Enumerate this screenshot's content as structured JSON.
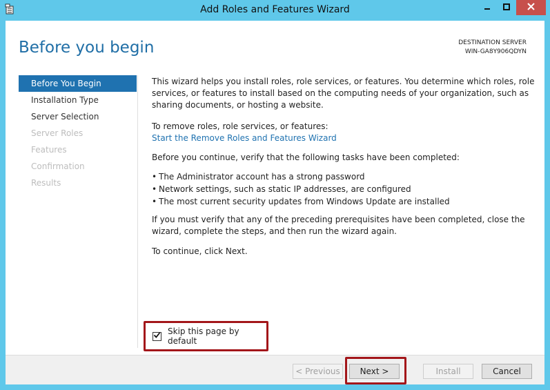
{
  "window": {
    "title": "Add Roles and Features Wizard"
  },
  "header": {
    "page_title": "Before you begin",
    "destination_label": "DESTINATION SERVER",
    "destination_server": "WIN-GA8Y906QDYN"
  },
  "nav": {
    "items": [
      {
        "label": "Before You Begin",
        "state": "selected"
      },
      {
        "label": "Installation Type",
        "state": "enabled"
      },
      {
        "label": "Server Selection",
        "state": "enabled"
      },
      {
        "label": "Server Roles",
        "state": "disabled"
      },
      {
        "label": "Features",
        "state": "disabled"
      },
      {
        "label": "Confirmation",
        "state": "disabled"
      },
      {
        "label": "Results",
        "state": "disabled"
      }
    ]
  },
  "content": {
    "intro": "This wizard helps you install roles, role services, or features. You determine which roles, role services, or features to install based on the computing needs of your organization, such as sharing documents, or hosting a website.",
    "remove_heading": "To remove roles, role services, or features:",
    "remove_link": "Start the Remove Roles and Features Wizard",
    "verify_heading": "Before you continue, verify that the following tasks have been completed:",
    "tasks": [
      "The Administrator account has a strong password",
      "Network settings, such as static IP addresses, are configured",
      "The most current security updates from Windows Update are installed"
    ],
    "prereq_note": "If you must verify that any of the preceding prerequisites have been completed, close the wizard, complete the steps, and then run the wizard again.",
    "continue_note": "To continue, click Next."
  },
  "skip": {
    "label": "Skip this page by default",
    "checked": true
  },
  "footer": {
    "previous_label": "< Previous",
    "next_label": "Next >",
    "install_label": "Install",
    "cancel_label": "Cancel"
  },
  "colors": {
    "window_frame": "#5fc8ea",
    "accent": "#1f72b0",
    "highlight_border": "#a3161a",
    "close_button": "#c7504b"
  }
}
